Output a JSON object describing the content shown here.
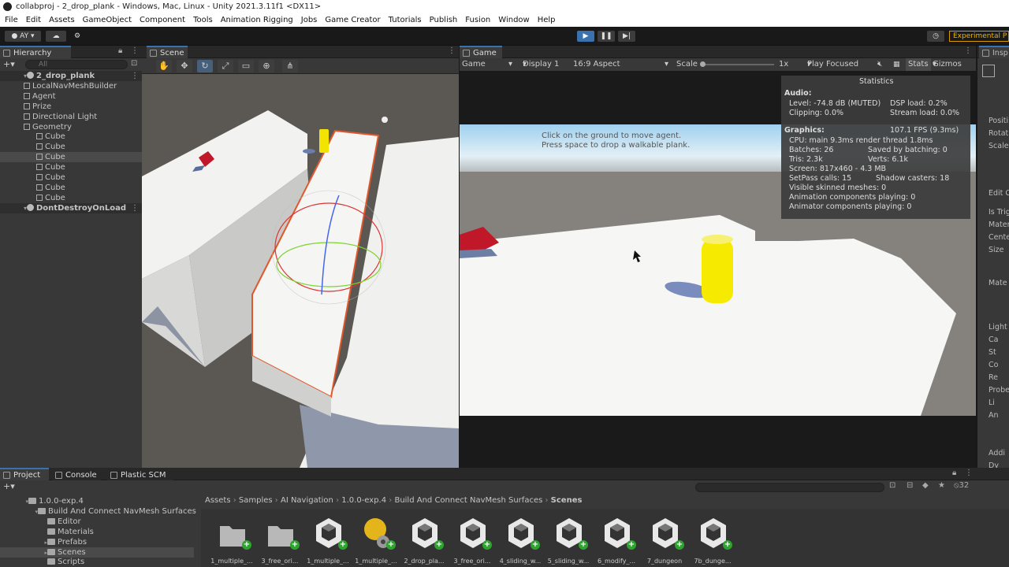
{
  "window_title": "collabproj - 2_drop_plank - Windows, Mac, Linux - Unity 2021.3.11f1 <DX11>",
  "menu": [
    "File",
    "Edit",
    "Assets",
    "GameObject",
    "Component",
    "Tools",
    "Animation Rigging",
    "Jobs",
    "Game Creator",
    "Tutorials",
    "Publish",
    "Fusion",
    "Window",
    "Help"
  ],
  "toolbar": {
    "account": "AY",
    "experimental": "Experimental P"
  },
  "hierarchy": {
    "tab": "Hierarchy",
    "search_placeholder": "All",
    "rows": [
      {
        "label": "2_drop_plank",
        "type": "scene"
      },
      {
        "label": "LocalNavMeshBuilder",
        "type": "go"
      },
      {
        "label": "Agent",
        "type": "go"
      },
      {
        "label": "Prize",
        "type": "go"
      },
      {
        "label": "Directional Light",
        "type": "go"
      },
      {
        "label": "Geometry",
        "type": "go"
      },
      {
        "label": "Cube",
        "type": "child"
      },
      {
        "label": "Cube",
        "type": "child"
      },
      {
        "label": "Cube",
        "type": "child-sel"
      },
      {
        "label": "Cube",
        "type": "child"
      },
      {
        "label": "Cube",
        "type": "child"
      },
      {
        "label": "Cube",
        "type": "child"
      },
      {
        "label": "Cube",
        "type": "child"
      },
      {
        "label": "DontDestroyOnLoad",
        "type": "scene"
      }
    ]
  },
  "scene": {
    "tab": "Scene"
  },
  "game": {
    "tab": "Game",
    "mode": "Game",
    "display": "Display 1",
    "aspect": "16:9 Aspect",
    "scale_label": "Scale",
    "scale_value": "1x",
    "play_focused": "Play Focused",
    "stats_btn": "Stats",
    "gizmos_btn": "Gizmos",
    "hint_line1": "Click on the ground to move agent.",
    "hint_line2": "Press space to drop a walkable plank."
  },
  "stats": {
    "title": "Statistics",
    "audio_header": "Audio:",
    "level": "Level: -74.8 dB (MUTED)",
    "clipping": "Clipping: 0.0%",
    "dsp": "DSP load: 0.2%",
    "stream": "Stream load: 0.0%",
    "graphics_header": "Graphics:",
    "fps": "107.1 FPS (9.3ms)",
    "cpu": "CPU: main 9.3ms  render thread 1.8ms",
    "batches": "Batches: 26",
    "saved": "Saved by batching: 0",
    "tris": "Tris: 2.3k",
    "verts": "Verts: 6.1k",
    "screen": "Screen: 817x460 - 4.3 MB",
    "setpass": "SetPass calls: 15",
    "shadow": "Shadow casters: 18",
    "skinned": "Visible skinned meshes: 0",
    "anim_comp": "Animation components playing: 0",
    "animator_comp": "Animator components playing: 0"
  },
  "inspector": {
    "tab": "Insp",
    "items": [
      "Positi",
      "Rotat",
      "Scale",
      "Edit C",
      "Is Trig",
      "Mater",
      "Cente",
      "Size",
      "Mate",
      "Light",
      "Ca",
      "St",
      "Co",
      "Re",
      "Probe",
      "Li",
      "An",
      "Addi",
      "Dy",
      "Re",
      "Scrip"
    ]
  },
  "project": {
    "tabs": [
      "Project",
      "Console",
      "Plastic SCM"
    ],
    "count": "32",
    "tree": [
      {
        "label": "1.0.0-exp.4",
        "indent": 1
      },
      {
        "label": "Build And Connect NavMesh Surfaces",
        "indent": 2
      },
      {
        "label": "Editor",
        "indent": 3
      },
      {
        "label": "Materials",
        "indent": 3
      },
      {
        "label": "Prefabs",
        "indent": 3
      },
      {
        "label": "Scenes",
        "indent": 3,
        "selected": true
      },
      {
        "label": "Scripts",
        "indent": 3
      }
    ],
    "breadcrumb": [
      "Assets",
      "Samples",
      "AI Navigation",
      "1.0.0-exp.4",
      "Build And Connect NavMesh Surfaces",
      "Scenes"
    ],
    "assets": [
      {
        "label": "1_multiple_...",
        "icon": "folder"
      },
      {
        "label": "3_free_ori...",
        "icon": "folder"
      },
      {
        "label": "1_multiple_...",
        "icon": "unity"
      },
      {
        "label": "1_multiple_...",
        "icon": "light"
      },
      {
        "label": "2_drop_pla...",
        "icon": "unity"
      },
      {
        "label": "3_free_ori...",
        "icon": "unity"
      },
      {
        "label": "4_sliding_w...",
        "icon": "unity"
      },
      {
        "label": "5_sliding_w...",
        "icon": "unity"
      },
      {
        "label": "6_modify_...",
        "icon": "unity"
      },
      {
        "label": "7_dungeon",
        "icon": "unity"
      },
      {
        "label": "7b_dunge...",
        "icon": "unity"
      }
    ]
  }
}
